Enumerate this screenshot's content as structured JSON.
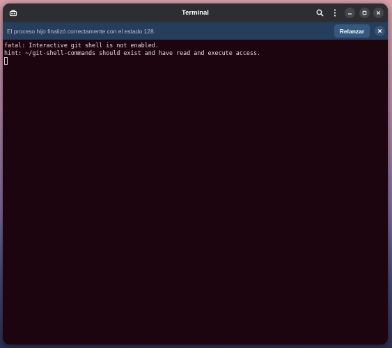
{
  "window": {
    "title": "Terminal"
  },
  "headerbar": {
    "icons": [
      "new-tab-icon",
      "search-icon",
      "menu-icon",
      "minimize-icon",
      "maximize-icon",
      "close-icon"
    ]
  },
  "infobar": {
    "message": "El proceso hijo finalizó correctamente con el estado 128.",
    "relaunch_label": "Relanzar"
  },
  "terminal": {
    "lines": [
      "fatal: Interactive git shell is not enabled.",
      "hint: ~/git-shell-commands should exist and have read and execute access."
    ]
  },
  "colors": {
    "terminal_bg": "#1c050e",
    "headerbar_bg": "#2e2e32",
    "infobar_bg": "#263d5b",
    "relaunch_bg": "#36587f"
  }
}
